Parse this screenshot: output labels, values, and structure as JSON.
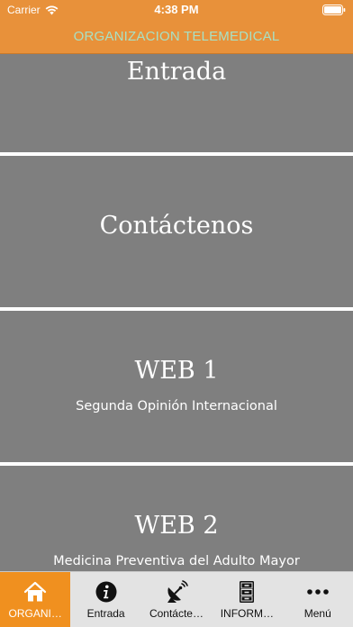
{
  "status_bar": {
    "carrier": "Carrier",
    "time": "4:38 PM"
  },
  "header": {
    "title": "ORGANIZACION TELEMEDICAL"
  },
  "panels": [
    {
      "title": "Entrada",
      "subtitle": ""
    },
    {
      "title": "Contáctenos",
      "subtitle": ""
    },
    {
      "title": "WEB 1",
      "subtitle": "Segunda Opinión Internacional"
    },
    {
      "title": "WEB 2",
      "subtitle": "Medicina Preventiva del Adulto Mayor"
    }
  ],
  "tabs": [
    {
      "label": "ORGANI…",
      "icon": "home-icon",
      "active": true
    },
    {
      "label": "Entrada",
      "icon": "info-icon",
      "active": false
    },
    {
      "label": "Contácte…",
      "icon": "satellite-dish-icon",
      "active": false
    },
    {
      "label": "INFORM…",
      "icon": "file-cabinet-icon",
      "active": false
    },
    {
      "label": "Menú",
      "icon": "more-icon",
      "active": false
    }
  ],
  "colors": {
    "header_bg": "#e8913a",
    "header_title": "#a8e0c4",
    "panel_bg": "#7f7f7f",
    "tab_active_bg": "#f0901f",
    "tab_bar_bg": "#e3e3e3"
  }
}
